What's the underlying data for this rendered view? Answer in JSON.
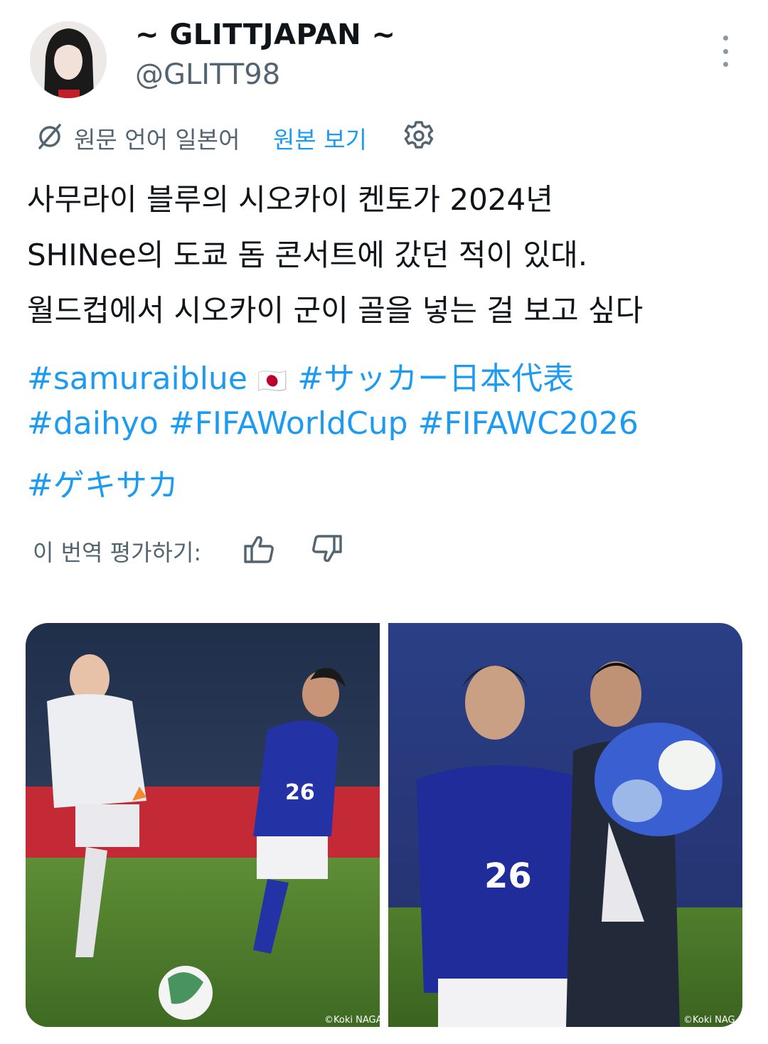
{
  "author": {
    "display_name": "~ GLITTJAPAN ~",
    "handle": "@GLITT98"
  },
  "translation": {
    "source_language_label": "원문 언어 일본어",
    "show_original_label": "원본 보기"
  },
  "tweet": {
    "lines": [
      "사무라이 블루의 시오카이 켄토가 2024년",
      "SHINee의 도쿄 돔 콘서트에 갔던 적이 있대.",
      "월드컵에서 시오카이 군이 골을 넣는 걸 보고 싶다"
    ],
    "hashtags": {
      "h1": "#samuraiblue",
      "flag": "🇯🇵",
      "h2": "#サッカー日本代表",
      "h3": "#daihyo",
      "h4": "#FIFAWorldCup",
      "h5": "#FIFAWC2026",
      "h6": "#ゲキサカ"
    }
  },
  "rating": {
    "label": "이 번역 평가하기:"
  },
  "media": {
    "photo1_credit": "©Koki NAGA",
    "photo2_credit": "©Koki NAG",
    "jersey_number": "26"
  },
  "icons": [
    "more-vertical-icon",
    "translate-icon",
    "gear-icon",
    "thumbs-up-icon",
    "thumbs-down-icon"
  ],
  "colors": {
    "link": "#1d9bf0",
    "secondary_text": "#536471",
    "primary_text": "#0f1419"
  }
}
